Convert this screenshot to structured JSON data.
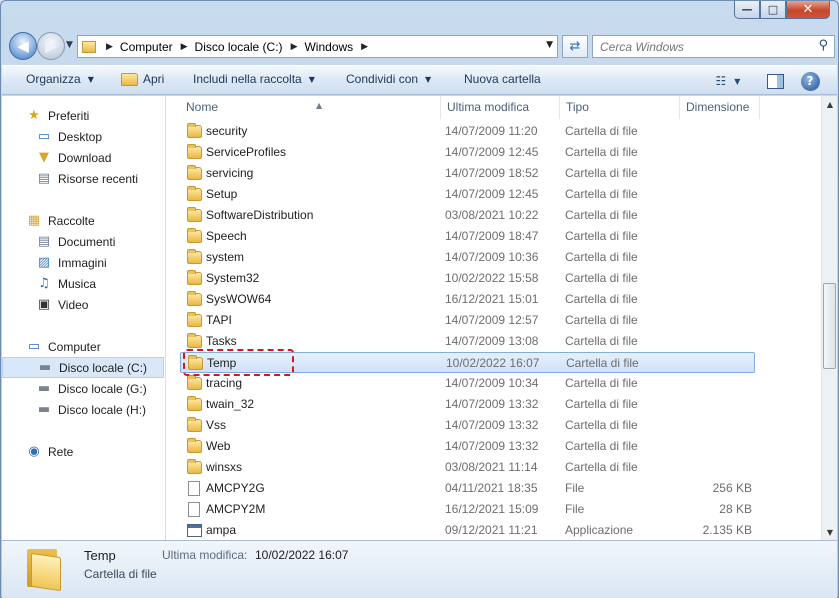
{
  "window": {
    "min_glyph": "—",
    "max_glyph": "□",
    "close_glyph": "✕"
  },
  "nav": {
    "back_glyph": "◀",
    "forward_glyph": "▶",
    "breadcrumb": [
      "Computer",
      "Disco locale (C:)",
      "Windows"
    ],
    "search_placeholder": "Cerca Windows"
  },
  "toolbar": {
    "organize": "Organizza",
    "open": "Apri",
    "include": "Includi nella raccolta",
    "share": "Condividi con",
    "new_folder": "Nuova cartella"
  },
  "sidebar": {
    "favorites": [
      {
        "label": "Preferiti",
        "icon": "star-icon"
      },
      {
        "label": "Desktop",
        "icon": "desktop-icon"
      },
      {
        "label": "Download",
        "icon": "download-folder-icon"
      },
      {
        "label": "Risorse recenti",
        "icon": "recent-places-icon"
      }
    ],
    "libraries": [
      {
        "label": "Raccolte",
        "icon": "libraries-icon"
      },
      {
        "label": "Documenti",
        "icon": "documents-icon"
      },
      {
        "label": "Immagini",
        "icon": "pictures-icon"
      },
      {
        "label": "Musica",
        "icon": "music-icon"
      },
      {
        "label": "Video",
        "icon": "video-icon"
      }
    ],
    "computer": [
      {
        "label": "Computer",
        "icon": "computer-icon"
      },
      {
        "label": "Disco locale (C:)",
        "icon": "drive-icon",
        "selected": true
      },
      {
        "label": "Disco locale (G:)",
        "icon": "drive-icon"
      },
      {
        "label": "Disco locale (H:)",
        "icon": "drive-icon"
      }
    ],
    "network": [
      {
        "label": "Rete",
        "icon": "network-icon"
      }
    ]
  },
  "columns": {
    "name": "Nome",
    "modified": "Ultima modifica",
    "type": "Tipo",
    "size": "Dimensione"
  },
  "files": [
    {
      "name": "security",
      "date": "14/07/2009 11:20",
      "type": "Cartella di file",
      "size": "",
      "kind": "folder"
    },
    {
      "name": "ServiceProfiles",
      "date": "14/07/2009 12:45",
      "type": "Cartella di file",
      "size": "",
      "kind": "folder"
    },
    {
      "name": "servicing",
      "date": "14/07/2009 18:52",
      "type": "Cartella di file",
      "size": "",
      "kind": "folder"
    },
    {
      "name": "Setup",
      "date": "14/07/2009 12:45",
      "type": "Cartella di file",
      "size": "",
      "kind": "folder"
    },
    {
      "name": "SoftwareDistribution",
      "date": "03/08/2021 10:22",
      "type": "Cartella di file",
      "size": "",
      "kind": "folder"
    },
    {
      "name": "Speech",
      "date": "14/07/2009 18:47",
      "type": "Cartella di file",
      "size": "",
      "kind": "folder"
    },
    {
      "name": "system",
      "date": "14/07/2009 10:36",
      "type": "Cartella di file",
      "size": "",
      "kind": "folder"
    },
    {
      "name": "System32",
      "date": "10/02/2022 15:58",
      "type": "Cartella di file",
      "size": "",
      "kind": "folder"
    },
    {
      "name": "SysWOW64",
      "date": "16/12/2021 15:01",
      "type": "Cartella di file",
      "size": "",
      "kind": "folder"
    },
    {
      "name": "TAPI",
      "date": "14/07/2009 12:57",
      "type": "Cartella di file",
      "size": "",
      "kind": "folder"
    },
    {
      "name": "Tasks",
      "date": "14/07/2009 13:08",
      "type": "Cartella di file",
      "size": "",
      "kind": "folder"
    },
    {
      "name": "Temp",
      "date": "10/02/2022 16:07",
      "type": "Cartella di file",
      "size": "",
      "kind": "folder",
      "selected": true
    },
    {
      "name": "tracing",
      "date": "14/07/2009 10:34",
      "type": "Cartella di file",
      "size": "",
      "kind": "folder"
    },
    {
      "name": "twain_32",
      "date": "14/07/2009 13:32",
      "type": "Cartella di file",
      "size": "",
      "kind": "folder"
    },
    {
      "name": "Vss",
      "date": "14/07/2009 13:32",
      "type": "Cartella di file",
      "size": "",
      "kind": "folder"
    },
    {
      "name": "Web",
      "date": "14/07/2009 13:32",
      "type": "Cartella di file",
      "size": "",
      "kind": "folder"
    },
    {
      "name": "winsxs",
      "date": "03/08/2021 11:14",
      "type": "Cartella di file",
      "size": "",
      "kind": "folder"
    },
    {
      "name": "AMCPY2G",
      "date": "04/11/2021 18:35",
      "type": "File",
      "size": "256 KB",
      "kind": "file"
    },
    {
      "name": "AMCPY2M",
      "date": "16/12/2021 15:09",
      "type": "File",
      "size": "28 KB",
      "kind": "file"
    },
    {
      "name": "ampa",
      "date": "09/12/2021 11:21",
      "type": "Applicazione",
      "size": "2.135 KB",
      "kind": "app"
    }
  ],
  "details": {
    "name": "Temp",
    "type": "Cartella di file",
    "modified_label": "Ultima modifica:",
    "modified_value": "10/02/2022 16:07"
  },
  "colors": {
    "highlight": "#d9141b",
    "selection": "#cfe2f7"
  }
}
